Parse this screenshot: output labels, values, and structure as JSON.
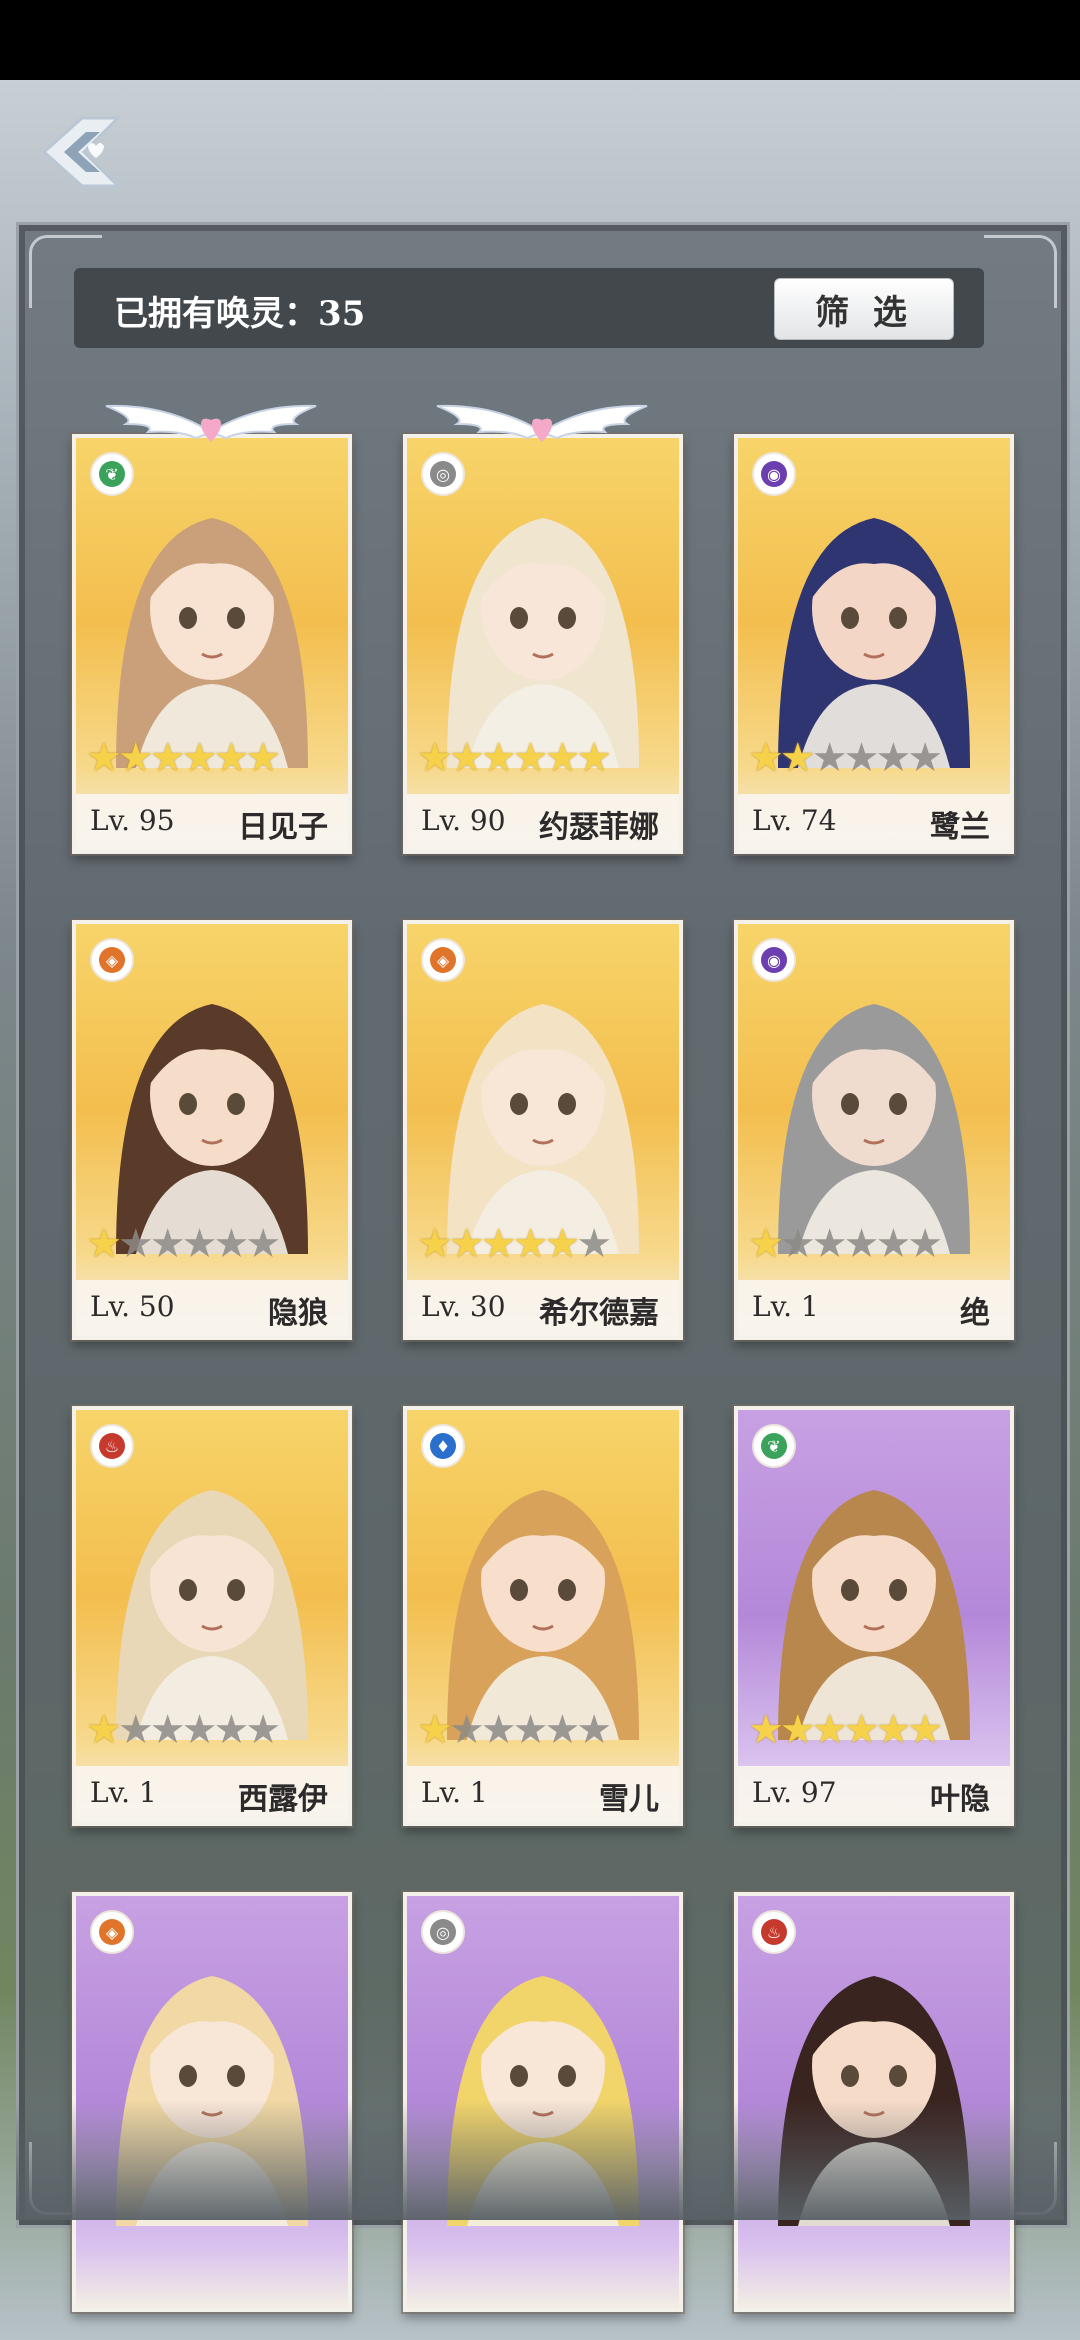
{
  "header": {
    "owned_label": "已拥有唤灵：35",
    "filter_label": "筛 选"
  },
  "cards": [
    {
      "name": "日见子",
      "level": "Lv. 95",
      "stars": 6,
      "frame": "gold",
      "element": "wind",
      "element_color": "#3aa25a",
      "winged": true,
      "hair": "#c9a07a",
      "skin": "#f8e3d2"
    },
    {
      "name": "约瑟菲娜",
      "level": "Lv. 90",
      "stars": 6,
      "frame": "gold",
      "element": "neutral",
      "element_color": "#8a8a8a",
      "winged": true,
      "hair": "#f0e6d0",
      "skin": "#f8e7d8"
    },
    {
      "name": "鹭兰",
      "level": "Lv. 74",
      "stars": 2,
      "frame": "gold",
      "element": "void",
      "element_color": "#6b3fb0",
      "winged": false,
      "hair": "#2f3570",
      "skin": "#f4d6c6"
    },
    {
      "name": "隐狼",
      "level": "Lv. 50",
      "stars": 1,
      "frame": "gold",
      "element": "earth",
      "element_color": "#e0742a",
      "winged": false,
      "hair": "#5a3a28",
      "skin": "#f6ddc9"
    },
    {
      "name": "希尔德嘉",
      "level": "Lv. 30",
      "stars": 5,
      "frame": "gold",
      "element": "earth",
      "element_color": "#e0742a",
      "winged": false,
      "hair": "#f3e2c4",
      "skin": "#f8e6d6"
    },
    {
      "name": "绝",
      "level": "Lv. 1",
      "stars": 1,
      "frame": "gold",
      "element": "void",
      "element_color": "#6b3fb0",
      "winged": false,
      "hair": "#9a9a9a",
      "skin": "#f0dccf"
    },
    {
      "name": "西露伊",
      "level": "Lv. 1",
      "stars": 1,
      "frame": "gold",
      "element": "fire",
      "element_color": "#c63a2e",
      "winged": false,
      "hair": "#e9d8b8",
      "skin": "#f8e4d4"
    },
    {
      "name": "雪儿",
      "level": "Lv. 1",
      "stars": 1,
      "frame": "gold",
      "element": "water",
      "element_color": "#2a6fcc",
      "winged": false,
      "hair": "#d8a25a",
      "skin": "#f7dfcb"
    },
    {
      "name": "叶隐",
      "level": "Lv. 97",
      "stars": 6,
      "frame": "purple",
      "element": "wind",
      "element_color": "#3aa25a",
      "winged": false,
      "hair": "#b8874e",
      "skin": "#f6dcc8"
    },
    {
      "name": "",
      "level": "",
      "stars": 0,
      "frame": "purple",
      "element": "earth",
      "element_color": "#e0742a",
      "winged": false,
      "hair": "#f1d8a4",
      "skin": "#f8e6d6"
    },
    {
      "name": "",
      "level": "",
      "stars": 0,
      "frame": "purple",
      "element": "neutral",
      "element_color": "#8a8a8a",
      "winged": false,
      "hair": "#f1d46a",
      "skin": "#f8e6d6"
    },
    {
      "name": "",
      "level": "",
      "stars": 0,
      "frame": "purple",
      "element": "fire",
      "element_color": "#c63a2e",
      "winged": false,
      "hair": "#3a2420",
      "skin": "#f6dcc8"
    }
  ]
}
